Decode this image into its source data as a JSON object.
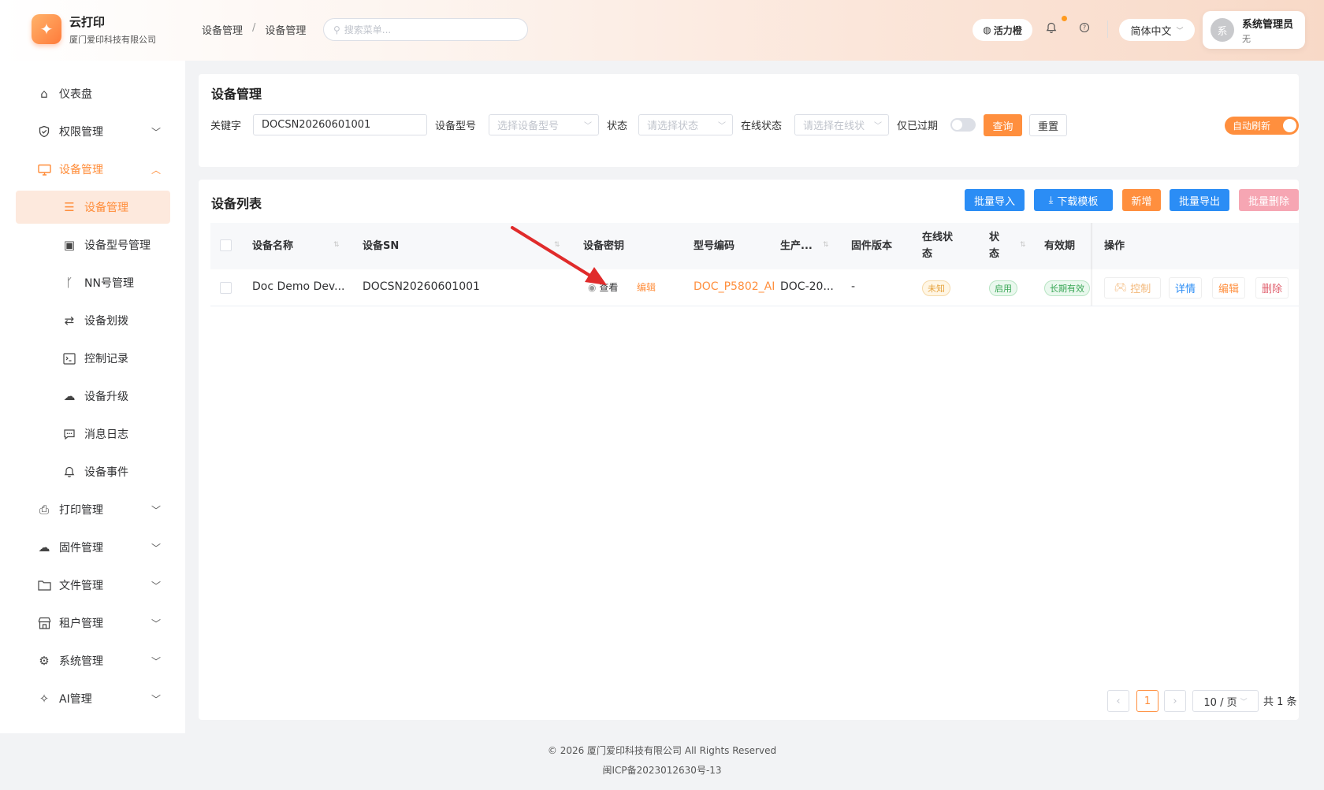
{
  "app": {
    "name": "云打印",
    "company": "厦门爱印科技有限公司",
    "logo_icon": "sparkle-icon"
  },
  "header": {
    "breadcrumb": [
      "设备管理",
      "设备管理"
    ],
    "breadcrumb_separator": "/",
    "search_placeholder": "搜索菜单...",
    "vitality_label": "活力橙",
    "language": "简体中文",
    "user": {
      "avatar_text": "系",
      "name": "系统管理员",
      "role": "无"
    },
    "notification_dot_color": "#ff9a1f"
  },
  "sidebar": {
    "items": [
      {
        "label": "仪表盘",
        "icon": "home-icon"
      },
      {
        "label": "权限管理",
        "icon": "shield-icon",
        "expandable": true
      },
      {
        "label": "设备管理",
        "icon": "monitor-icon",
        "expandable": true,
        "expanded": true,
        "active": true
      },
      {
        "label": "设备管理",
        "icon": "list-icon",
        "sub": true,
        "active": true
      },
      {
        "label": "设备型号管理",
        "icon": "chip-icon",
        "sub": true
      },
      {
        "label": "NN号管理",
        "icon": "branch-icon",
        "sub": true
      },
      {
        "label": "设备划拨",
        "icon": "transfer-icon",
        "sub": true
      },
      {
        "label": "控制记录",
        "icon": "terminal-icon",
        "sub": true
      },
      {
        "label": "设备升级",
        "icon": "cloud-upgrade-icon",
        "sub": true
      },
      {
        "label": "消息日志",
        "icon": "message-icon",
        "sub": true
      },
      {
        "label": "设备事件",
        "icon": "bell-icon",
        "sub": true
      },
      {
        "label": "打印管理",
        "icon": "printer-icon",
        "expandable": true
      },
      {
        "label": "固件管理",
        "icon": "cloud-upload-icon",
        "expandable": true
      },
      {
        "label": "文件管理",
        "icon": "folder-icon",
        "expandable": true
      },
      {
        "label": "租户管理",
        "icon": "store-icon",
        "expandable": true
      },
      {
        "label": "系统管理",
        "icon": "gear-icon",
        "expandable": true
      },
      {
        "label": "AI管理",
        "icon": "ai-sparkle-icon",
        "expandable": true
      }
    ],
    "accent_color": "#ff8c38"
  },
  "filter": {
    "title": "设备管理",
    "keyword_label": "关键字",
    "keyword_value": "DOCSN20260601001",
    "model_label": "设备型号",
    "model_placeholder": "选择设备型号",
    "status_label": "状态",
    "status_placeholder": "请选择状态",
    "online_label": "在线状态",
    "online_placeholder": "请选择在线状",
    "expired_label": "仅已过期",
    "expired_on": false,
    "query_button": "查询",
    "reset_button": "重置",
    "auto_refresh_label": "自动刷新",
    "auto_refresh_on": true
  },
  "list": {
    "title": "设备列表",
    "actions": {
      "import": "批量导入",
      "template": "下载模板",
      "add": "新增",
      "export": "批量导出",
      "delete": "批量删除"
    },
    "columns": {
      "name": "设备名称",
      "sn": "设备SN",
      "secret": "设备密钥",
      "model_code": "型号编码",
      "production": "生产...",
      "firmware": "固件版本",
      "online": "在线状态",
      "status": "状态",
      "validity": "有效期",
      "ops": "操作"
    },
    "rows": [
      {
        "name": "Doc Demo Dev...",
        "sn": "DOCSN20260601001",
        "secret_view": "查看",
        "secret_edit": "编辑",
        "model_code": "DOC_P5802_AI",
        "production": "DOC-20...",
        "firmware": "-",
        "online": "未知",
        "status": "启用",
        "validity": "长期有效",
        "op_control": "控制",
        "op_detail": "详情",
        "op_edit": "编辑",
        "op_delete": "删除"
      }
    ]
  },
  "pagination": {
    "current_page": "1",
    "page_size": "10 / 页",
    "total": "共 1 条",
    "prev_icon": "chevron-left-icon",
    "next_icon": "chevron-right-icon"
  },
  "footer": {
    "copyright": "© 2026 厦门爱印科技有限公司 All Rights Reserved",
    "icp": "闽ICP备2023012630号-13"
  }
}
